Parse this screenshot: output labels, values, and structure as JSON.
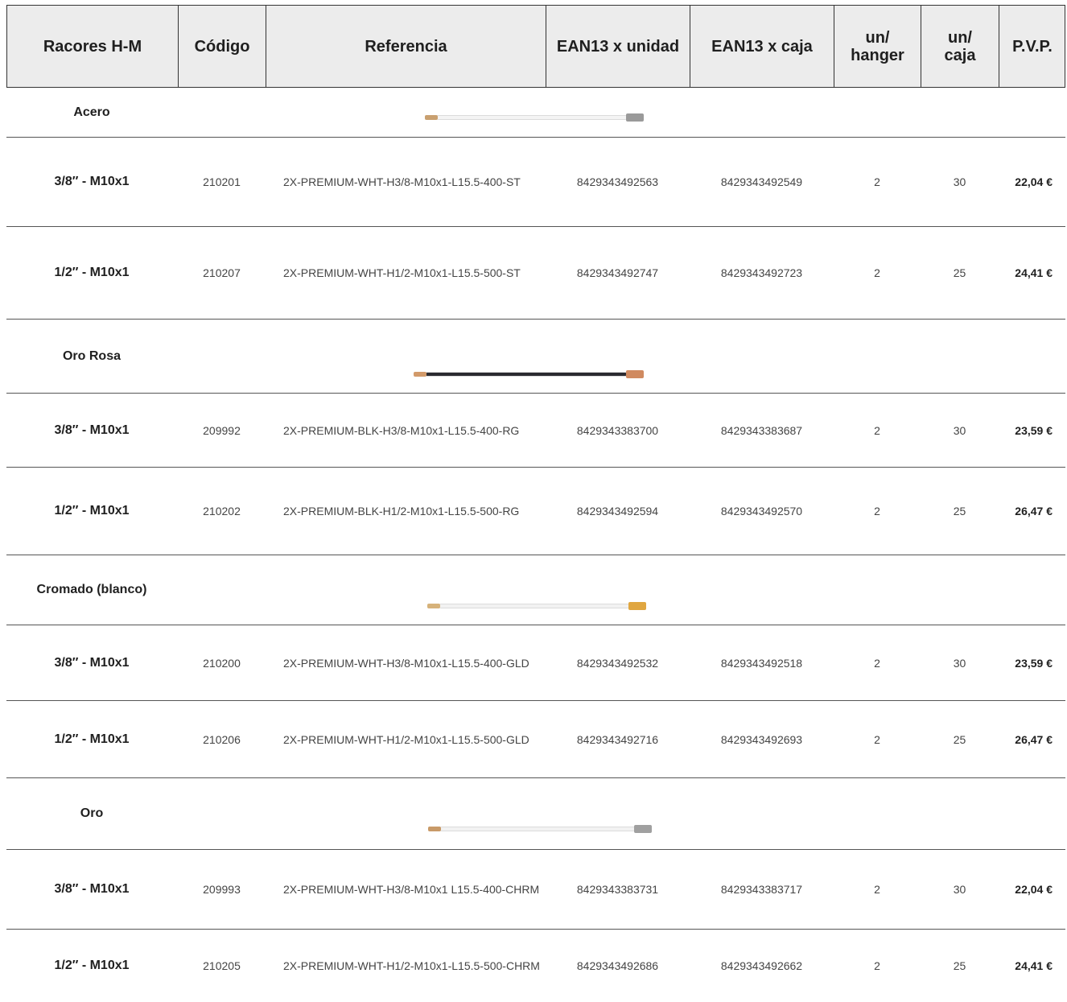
{
  "headers": {
    "name": "Racores H-M",
    "code": "Código",
    "reference": "Referencia",
    "ean_unit": "EAN13 x unidad",
    "ean_box": "EAN13 x caja",
    "un_hanger": "un/ hanger",
    "un_box": "un/ caja",
    "price": "P.V.P."
  },
  "groups": [
    {
      "name": "Acero",
      "hose_colors": {
        "tube": "#f4f4f4",
        "left_tip": "#c9a070",
        "right_nut": "#9a9a9a"
      },
      "rows": [
        {
          "size": "3/8″ - M10x1",
          "code": "210201",
          "reference": "2X-PREMIUM-WHT-H3/8-M10x1-L15.5-400-ST",
          "ean_unit": "8429343492563",
          "ean_box": "8429343492549",
          "un_hanger": "2",
          "un_box": "30",
          "price": "22,04 €"
        },
        {
          "size": "1/2″ - M10x1",
          "code": "210207",
          "reference": "2X-PREMIUM-WHT-H1/2-M10x1-L15.5-500-ST",
          "ean_unit": "8429343492747",
          "ean_box": "8429343492723",
          "un_hanger": "2",
          "un_box": "25",
          "price": "24,41 €"
        }
      ]
    },
    {
      "name": "Oro Rosa",
      "hose_colors": {
        "tube": "#2a2a30",
        "left_tip": "#d29a6a",
        "right_nut": "#d08a60"
      },
      "rows": [
        {
          "size": "3/8″ - M10x1",
          "code": "209992",
          "reference": "2X-PREMIUM-BLK-H3/8-M10x1-L15.5-400-RG",
          "ean_unit": "8429343383700",
          "ean_box": "8429343383687",
          "un_hanger": "2",
          "un_box": "30",
          "price": "23,59 €"
        },
        {
          "size": "1/2″ - M10x1",
          "code": "210202",
          "reference": "2X-PREMIUM-BLK-H1/2-M10x1-L15.5-500-RG",
          "ean_unit": "8429343492594",
          "ean_box": "8429343492570",
          "un_hanger": "2",
          "un_box": "25",
          "price": "26,47 €"
        }
      ]
    },
    {
      "name": "Cromado (blanco)",
      "hose_colors": {
        "tube": "#f2f2f2",
        "left_tip": "#d6b27a",
        "right_nut": "#e0a640"
      },
      "rows": [
        {
          "size": "3/8″ - M10x1",
          "code": "210200",
          "reference": "2X-PREMIUM-WHT-H3/8-M10x1-L15.5-400-GLD",
          "ean_unit": "8429343492532",
          "ean_box": "8429343492518",
          "un_hanger": "2",
          "un_box": "30",
          "price": "23,59 €"
        },
        {
          "size": "1/2″ - M10x1",
          "code": "210206",
          "reference": "2X-PREMIUM-WHT-H1/2-M10x1-L15.5-500-GLD",
          "ean_unit": "8429343492716",
          "ean_box": "8429343492693",
          "un_hanger": "2",
          "un_box": "25",
          "price": "26,47 €"
        }
      ]
    },
    {
      "name": "Oro",
      "hose_colors": {
        "tube": "#f2f2f2",
        "left_tip": "#c89a68",
        "right_nut": "#a0a0a0"
      },
      "rows": [
        {
          "size": "3/8″ - M10x1",
          "code": "209993",
          "reference": "2X-PREMIUM-WHT-H3/8-M10x1 L15.5-400-CHRM",
          "ean_unit": "8429343383731",
          "ean_box": "8429343383717",
          "un_hanger": "2",
          "un_box": "30",
          "price": "22,04 €"
        },
        {
          "size": "1/2″ - M10x1",
          "code": "210205",
          "reference": "2X-PREMIUM-WHT-H1/2-M10x1-L15.5-500-CHRM",
          "ean_unit": "8429343492686",
          "ean_box": "8429343492662",
          "un_hanger": "2",
          "un_box": "25",
          "price": "24,41 €"
        }
      ]
    }
  ]
}
